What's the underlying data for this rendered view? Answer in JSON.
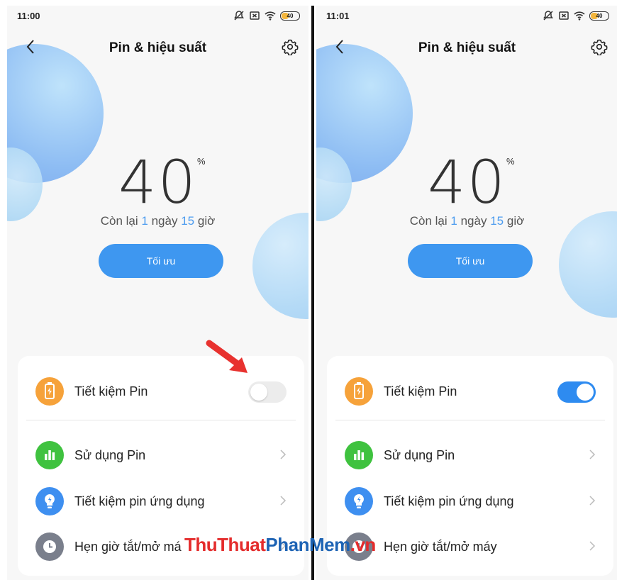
{
  "left_screen": {
    "time": "11:00",
    "battery_level": "40",
    "title": "Pin & hiệu suất",
    "percent": "40",
    "percent_symbol": "%",
    "remaining": {
      "prefix": "Còn lại",
      "days": "1",
      "days_unit": "ngày",
      "hours": "15",
      "hours_unit": "giờ"
    },
    "optimize_label": "Tối ưu",
    "battery_saver": {
      "label": "Tiết kiệm Pin",
      "enabled": false
    },
    "items": [
      {
        "label": "Sử dụng Pin",
        "icon": "bar-chart-icon",
        "color": "#3fc23f"
      },
      {
        "label": "Tiết kiệm pin ứng dụng",
        "icon": "lightbulb-icon",
        "color": "#3e8ff0"
      },
      {
        "label": "Hẹn giờ tắt/mở má",
        "icon": "clock-icon",
        "color": "#7a7f8c"
      }
    ]
  },
  "right_screen": {
    "time": "11:01",
    "battery_level": "40",
    "title": "Pin & hiệu suất",
    "percent": "40",
    "percent_symbol": "%",
    "remaining": {
      "prefix": "Còn lại",
      "days": "1",
      "days_unit": "ngày",
      "hours": "15",
      "hours_unit": "giờ"
    },
    "optimize_label": "Tối ưu",
    "battery_saver": {
      "label": "Tiết kiệm Pin",
      "enabled": true
    },
    "items": [
      {
        "label": "Sử dụng Pin",
        "icon": "bar-chart-icon",
        "color": "#3fc23f"
      },
      {
        "label": "Tiết kiệm pin ứng dụng",
        "icon": "lightbulb-icon",
        "color": "#3e8ff0"
      },
      {
        "label": "Hẹn giờ tắt/mở máy",
        "icon": "clock-icon",
        "color": "#7a7f8c"
      }
    ]
  },
  "colors": {
    "accent": "#3e97f0",
    "saver_icon": "#f6a23a",
    "toggle_on": "#2e8bf0",
    "arrow": "#e8322f"
  },
  "watermark": {
    "part1": "ThuThuat",
    "part2": "PhanMem",
    "part3": ".vn"
  }
}
